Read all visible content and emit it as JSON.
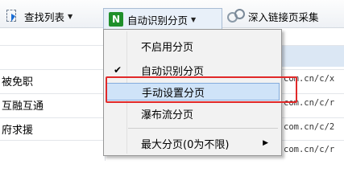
{
  "toolbar": {
    "find_list_label": "查找列表",
    "auto_paging_label": "自动识别分页",
    "auto_paging_icon_text": "N",
    "deep_link_label": "深入链接页采集"
  },
  "grid": {
    "rows": [
      {
        "left": "",
        "url": ""
      },
      {
        "left": "被免职",
        "url": "com.cn/c/x"
      },
      {
        "left": "互融互通",
        "url": "com.cn/c/r"
      },
      {
        "left": "府求援",
        "url": "com.cn/c/2"
      },
      {
        "left": "",
        "url": "com.cn/c/r"
      }
    ]
  },
  "menu": {
    "items": [
      {
        "label": "不启用分页",
        "checked": false
      },
      {
        "label": "自动识别分页",
        "checked": true
      },
      {
        "label": "手动设置分页",
        "checked": false
      },
      {
        "label": "瀑布流分页",
        "checked": false
      },
      {
        "label": "最大分页(0为不限)",
        "checked": false
      }
    ],
    "check_glyph": "✔",
    "submenu_glyph": "▶"
  },
  "colors": {
    "highlight": "#cfe3f8",
    "annotation_box": "#e12929"
  }
}
